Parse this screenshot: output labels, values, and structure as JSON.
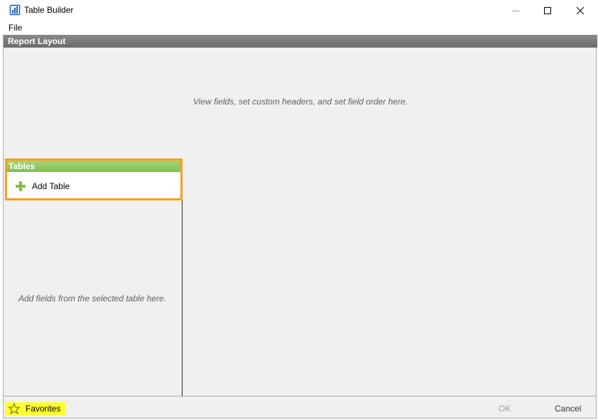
{
  "window": {
    "title": "Table Builder",
    "app_icon": "table-builder-icon"
  },
  "menu": {
    "items": [
      {
        "label": "File"
      }
    ]
  },
  "report_layout": {
    "header": "Report Layout",
    "hint": "View fields, set custom headers, and set field order here."
  },
  "tables": {
    "header": "Tables",
    "add_label": "Add Table",
    "add_icon": "plus-icon",
    "fields_hint": "Add fields from the selected table here."
  },
  "footer": {
    "favorites_label": "Favorites",
    "favorites_icon": "star-icon",
    "ok_label": "OK",
    "cancel_label": "Cancel"
  },
  "colors": {
    "highlight_border": "#f5a11c",
    "favorites_highlight": "#ffff2e",
    "tables_header": "#8cc85f",
    "report_header": "#7a7a7a"
  }
}
